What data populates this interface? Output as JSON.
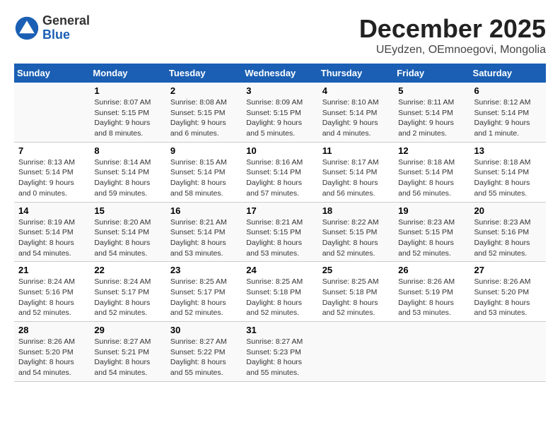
{
  "header": {
    "logo_general": "General",
    "logo_blue": "Blue",
    "month_title": "December 2025",
    "subtitle": "UEydzen, OEmnoegovi, Mongolia"
  },
  "weekdays": [
    "Sunday",
    "Monday",
    "Tuesday",
    "Wednesday",
    "Thursday",
    "Friday",
    "Saturday"
  ],
  "weeks": [
    [
      {
        "day": "",
        "info": ""
      },
      {
        "day": "1",
        "info": "Sunrise: 8:07 AM\nSunset: 5:15 PM\nDaylight: 9 hours\nand 8 minutes."
      },
      {
        "day": "2",
        "info": "Sunrise: 8:08 AM\nSunset: 5:15 PM\nDaylight: 9 hours\nand 6 minutes."
      },
      {
        "day": "3",
        "info": "Sunrise: 8:09 AM\nSunset: 5:15 PM\nDaylight: 9 hours\nand 5 minutes."
      },
      {
        "day": "4",
        "info": "Sunrise: 8:10 AM\nSunset: 5:14 PM\nDaylight: 9 hours\nand 4 minutes."
      },
      {
        "day": "5",
        "info": "Sunrise: 8:11 AM\nSunset: 5:14 PM\nDaylight: 9 hours\nand 2 minutes."
      },
      {
        "day": "6",
        "info": "Sunrise: 8:12 AM\nSunset: 5:14 PM\nDaylight: 9 hours\nand 1 minute."
      }
    ],
    [
      {
        "day": "7",
        "info": "Sunrise: 8:13 AM\nSunset: 5:14 PM\nDaylight: 9 hours\nand 0 minutes."
      },
      {
        "day": "8",
        "info": "Sunrise: 8:14 AM\nSunset: 5:14 PM\nDaylight: 8 hours\nand 59 minutes."
      },
      {
        "day": "9",
        "info": "Sunrise: 8:15 AM\nSunset: 5:14 PM\nDaylight: 8 hours\nand 58 minutes."
      },
      {
        "day": "10",
        "info": "Sunrise: 8:16 AM\nSunset: 5:14 PM\nDaylight: 8 hours\nand 57 minutes."
      },
      {
        "day": "11",
        "info": "Sunrise: 8:17 AM\nSunset: 5:14 PM\nDaylight: 8 hours\nand 56 minutes."
      },
      {
        "day": "12",
        "info": "Sunrise: 8:18 AM\nSunset: 5:14 PM\nDaylight: 8 hours\nand 56 minutes."
      },
      {
        "day": "13",
        "info": "Sunrise: 8:18 AM\nSunset: 5:14 PM\nDaylight: 8 hours\nand 55 minutes."
      }
    ],
    [
      {
        "day": "14",
        "info": "Sunrise: 8:19 AM\nSunset: 5:14 PM\nDaylight: 8 hours\nand 54 minutes."
      },
      {
        "day": "15",
        "info": "Sunrise: 8:20 AM\nSunset: 5:14 PM\nDaylight: 8 hours\nand 54 minutes."
      },
      {
        "day": "16",
        "info": "Sunrise: 8:21 AM\nSunset: 5:14 PM\nDaylight: 8 hours\nand 53 minutes."
      },
      {
        "day": "17",
        "info": "Sunrise: 8:21 AM\nSunset: 5:15 PM\nDaylight: 8 hours\nand 53 minutes."
      },
      {
        "day": "18",
        "info": "Sunrise: 8:22 AM\nSunset: 5:15 PM\nDaylight: 8 hours\nand 52 minutes."
      },
      {
        "day": "19",
        "info": "Sunrise: 8:23 AM\nSunset: 5:15 PM\nDaylight: 8 hours\nand 52 minutes."
      },
      {
        "day": "20",
        "info": "Sunrise: 8:23 AM\nSunset: 5:16 PM\nDaylight: 8 hours\nand 52 minutes."
      }
    ],
    [
      {
        "day": "21",
        "info": "Sunrise: 8:24 AM\nSunset: 5:16 PM\nDaylight: 8 hours\nand 52 minutes."
      },
      {
        "day": "22",
        "info": "Sunrise: 8:24 AM\nSunset: 5:17 PM\nDaylight: 8 hours\nand 52 minutes."
      },
      {
        "day": "23",
        "info": "Sunrise: 8:25 AM\nSunset: 5:17 PM\nDaylight: 8 hours\nand 52 minutes."
      },
      {
        "day": "24",
        "info": "Sunrise: 8:25 AM\nSunset: 5:18 PM\nDaylight: 8 hours\nand 52 minutes."
      },
      {
        "day": "25",
        "info": "Sunrise: 8:25 AM\nSunset: 5:18 PM\nDaylight: 8 hours\nand 52 minutes."
      },
      {
        "day": "26",
        "info": "Sunrise: 8:26 AM\nSunset: 5:19 PM\nDaylight: 8 hours\nand 53 minutes."
      },
      {
        "day": "27",
        "info": "Sunrise: 8:26 AM\nSunset: 5:20 PM\nDaylight: 8 hours\nand 53 minutes."
      }
    ],
    [
      {
        "day": "28",
        "info": "Sunrise: 8:26 AM\nSunset: 5:20 PM\nDaylight: 8 hours\nand 54 minutes."
      },
      {
        "day": "29",
        "info": "Sunrise: 8:27 AM\nSunset: 5:21 PM\nDaylight: 8 hours\nand 54 minutes."
      },
      {
        "day": "30",
        "info": "Sunrise: 8:27 AM\nSunset: 5:22 PM\nDaylight: 8 hours\nand 55 minutes."
      },
      {
        "day": "31",
        "info": "Sunrise: 8:27 AM\nSunset: 5:23 PM\nDaylight: 8 hours\nand 55 minutes."
      },
      {
        "day": "",
        "info": ""
      },
      {
        "day": "",
        "info": ""
      },
      {
        "day": "",
        "info": ""
      }
    ]
  ]
}
